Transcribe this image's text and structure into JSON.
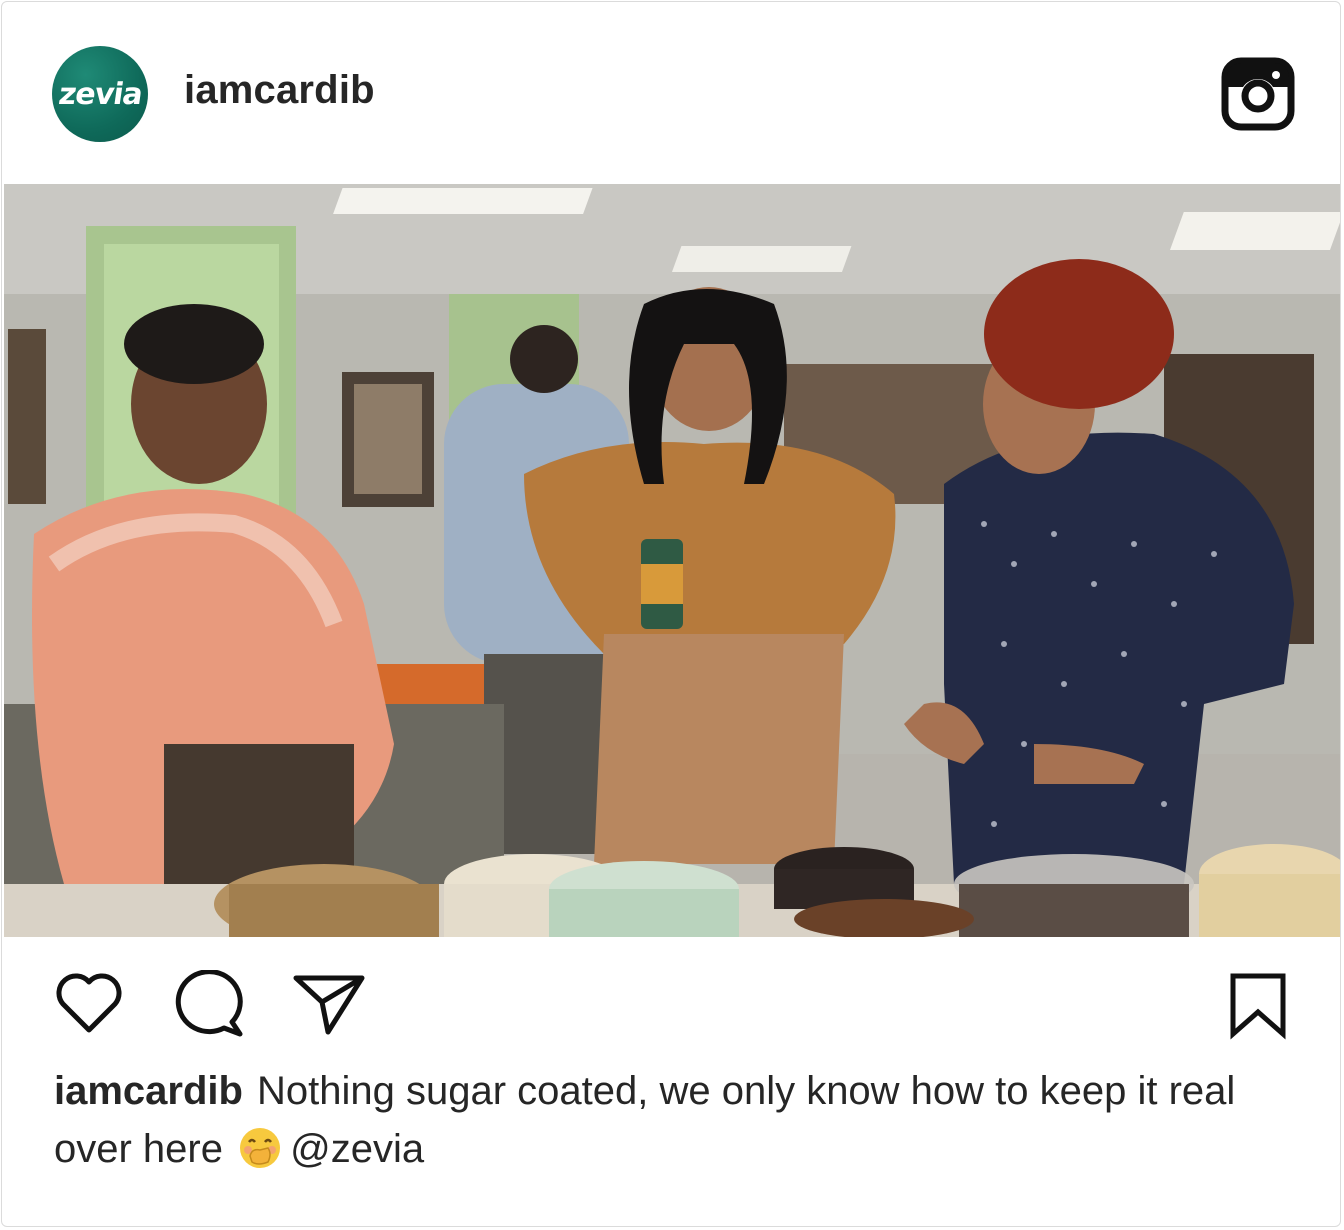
{
  "post": {
    "account": {
      "avatar_text": "zevia",
      "username": "iamcardib"
    },
    "icons": {
      "header_right": "instagram-logo-icon",
      "actions": [
        "heart-icon",
        "comment-icon",
        "share-icon"
      ],
      "save": "bookmark-icon"
    },
    "caption": {
      "username": "iamcardib",
      "text": "Nothing sugar coated, we only know how to keep it real over here",
      "emoji": "face-with-hand-over-mouth",
      "mention": "@zevia"
    },
    "colors": {
      "avatar_bg": "#0f6a5a",
      "text": "#262626",
      "border": "#dbdbdb"
    }
  }
}
